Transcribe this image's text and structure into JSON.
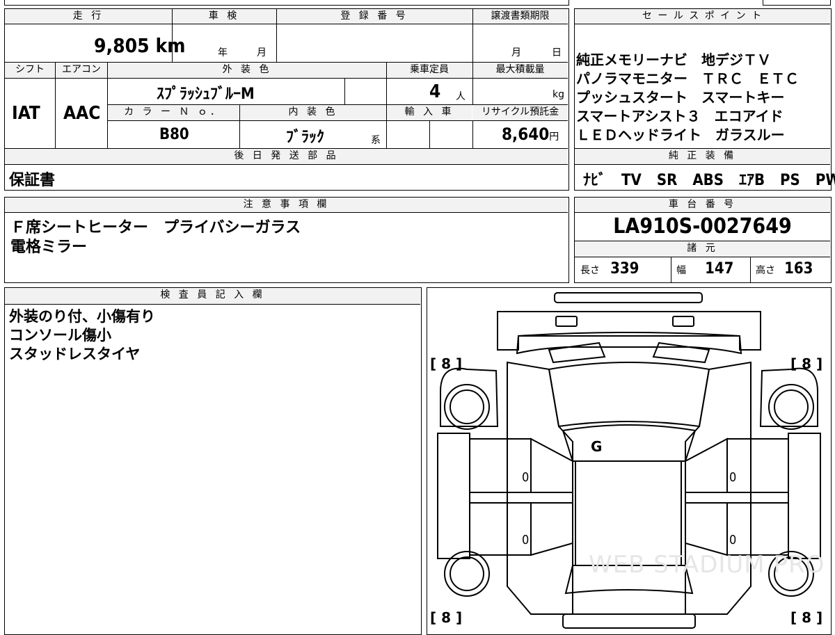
{
  "mileage": {
    "label": "走 行",
    "value": "9,805",
    "unit": "km"
  },
  "inspection": {
    "label": "車 検",
    "year_unit": "年",
    "month_unit": "月"
  },
  "registration": {
    "label": "登 録 番 号"
  },
  "transfer_deadline": {
    "label": "譲渡書類期限",
    "month_unit": "月",
    "day_unit": "日"
  },
  "sales_points": {
    "label": "セ ー ル ス ポ イ ン ト",
    "lines": [
      "純正メモリーナビ　地デジＴＶ",
      "パノラマモニター　ＴＲＣ　ＥＴＣ",
      "プッシュスタート　スマートキー",
      "スマートアシスト３　エコアイド",
      "ＬＥＤヘッドライト　ガラスルー"
    ]
  },
  "shift": {
    "label": "シフト",
    "value": "IAT"
  },
  "aircon": {
    "label": "エアコン",
    "value": "AAC"
  },
  "exterior_color": {
    "label": "外 装 色",
    "value": "ｽﾌﾟﾗｯｼｭﾌﾞﾙｰM"
  },
  "capacity": {
    "label": "乗車定員",
    "value": "4",
    "unit": "人"
  },
  "max_load": {
    "label": "最大積載量",
    "unit": "kg"
  },
  "color_no": {
    "label": "カ ラ ー Ｎ ｏ．",
    "value": "B80"
  },
  "interior_color": {
    "label": "内 装 色",
    "value": "ﾌﾞﾗｯｸ",
    "suffix": "系"
  },
  "import": {
    "label": "輸 入 車"
  },
  "recycle": {
    "label": "リサイクル預託金",
    "value": "8,640",
    "unit": "円"
  },
  "later_parts": {
    "label": "後 日 発 送 部 品",
    "value": "保証書"
  },
  "equipment": {
    "label": "純 正 装 備",
    "value": "ﾅﾋﾞ　TV　SR　ABS　ｴｱB　PS　PW"
  },
  "notes": {
    "label": "注 意 事 項 欄",
    "lines": [
      "Ｆ席シートヒーター　プライバシーガラス",
      "電格ミラー"
    ]
  },
  "chassis": {
    "label": "車 台 番 号",
    "value": "LA910S-0027649"
  },
  "specs": {
    "label": "諸 元",
    "length_label": "長さ",
    "length": "339",
    "width_label": "幅",
    "width": "147",
    "height_label": "高さ",
    "height": "163"
  },
  "inspector": {
    "label": "検 査 員 記 入 欄",
    "lines": [
      "外装のり付、小傷有り",
      "コンソール傷小",
      "スタッドレスタイヤ"
    ]
  },
  "diagram": {
    "tire_fl": "[ 8 ]",
    "tire_fr": "[ 8 ]",
    "tire_rl": "[ 8 ]",
    "tire_rr": "[ 8 ]",
    "glass_mark": "G",
    "door_mark_1": "0",
    "door_mark_2": "0",
    "door_mark_3": "0",
    "door_mark_4": "0",
    "watermark": "WEB STADIUM PRO"
  }
}
